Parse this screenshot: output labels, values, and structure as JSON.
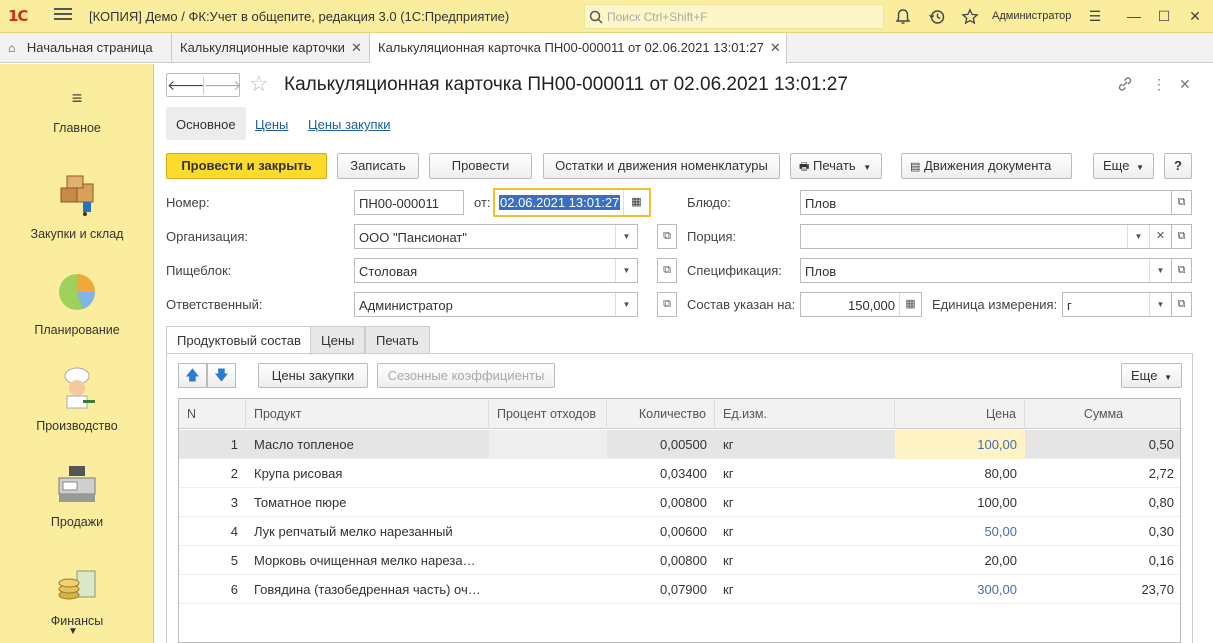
{
  "app": {
    "logo": "1С",
    "title": "[КОПИЯ] Демо / ФК:Учет в общепите, редакция 3.0  (1С:Предприятие)",
    "search_placeholder": "Поиск Ctrl+Shift+F",
    "user": "Администратор"
  },
  "tabs": [
    {
      "label": "Начальная страница"
    },
    {
      "label": "Калькуляционные карточки"
    },
    {
      "label": "Калькуляционная карточка ПН00-000011 от 02.06.2021 13:01:27"
    }
  ],
  "sidebar": [
    {
      "label": "Главное",
      "icon": "menu-icon"
    },
    {
      "label": "Закупки и склад",
      "icon": "boxes-cart-icon"
    },
    {
      "label": "Планирование",
      "icon": "pie-chart-icon"
    },
    {
      "label": "Производство",
      "icon": "chef-icon"
    },
    {
      "label": "Продажи",
      "icon": "cash-register-icon"
    },
    {
      "label": "Финансы",
      "icon": "coins-icon"
    }
  ],
  "doc": {
    "title": "Калькуляционная карточка ПН00-000011 от 02.06.2021 13:01:27",
    "form_tabs": [
      "Основное",
      "Цены",
      "Цены закупки"
    ],
    "buttons": {
      "post_close": "Провести и закрыть",
      "save": "Записать",
      "post": "Провести",
      "balances": "Остатки и движения номенклатуры",
      "print": "Печать",
      "movements": "Движения документа",
      "more": "Еще",
      "help": "?"
    }
  },
  "fields": {
    "number_label": "Номер:",
    "number": "ПН00-000011",
    "date_label": "от:",
    "date": "02.06.2021 13:01:27",
    "org_label": "Организация:",
    "org": "ООО \"Пансионат\"",
    "unit_label": "Пищеблок:",
    "unit": "Столовая",
    "resp_label": "Ответственный:",
    "resp": "Администратор",
    "dish_label": "Блюдо:",
    "dish": "Плов",
    "portion_label": "Порция:",
    "portion": "",
    "spec_label": "Спецификация:",
    "spec": "Плов",
    "comp_label": "Состав указан на:",
    "comp": "150,000",
    "uom_label": "Единица измерения:",
    "uom": "г"
  },
  "subtabs": [
    "Продуктовый состав",
    "Цены",
    "Печать"
  ],
  "table_toolbar": {
    "buy_prices": "Цены закупки",
    "seasonal": "Сезонные коэффициенты",
    "more": "Еще"
  },
  "table": {
    "columns": [
      "N",
      "Продукт",
      "Процент отходов",
      "Количество",
      "Ед.изм.",
      "Цена",
      "Сумма"
    ],
    "rows": [
      {
        "n": "1",
        "product": "Масло топленое",
        "waste": "",
        "qty": "0,00500",
        "uom": "кг",
        "price": "100,00",
        "sum": "0,50"
      },
      {
        "n": "2",
        "product": "Крупа рисовая",
        "waste": "",
        "qty": "0,03400",
        "uom": "кг",
        "price": "80,00",
        "sum": "2,72"
      },
      {
        "n": "3",
        "product": "Томатное пюре",
        "waste": "",
        "qty": "0,00800",
        "uom": "кг",
        "price": "100,00",
        "sum": "0,80"
      },
      {
        "n": "4",
        "product": "Лук репчатый мелко нарезанный",
        "waste": "",
        "qty": "0,00600",
        "uom": "кг",
        "price": "50,00",
        "sum": "0,30"
      },
      {
        "n": "5",
        "product": "Морковь очищенная мелко нареза…",
        "waste": "",
        "qty": "0,00800",
        "uom": "кг",
        "price": "20,00",
        "sum": "0,16"
      },
      {
        "n": "6",
        "product": "Говядина (тазобедренная часть) оч…",
        "waste": "",
        "qty": "0,07900",
        "uom": "кг",
        "price": "300,00",
        "sum": "23,70"
      }
    ]
  }
}
